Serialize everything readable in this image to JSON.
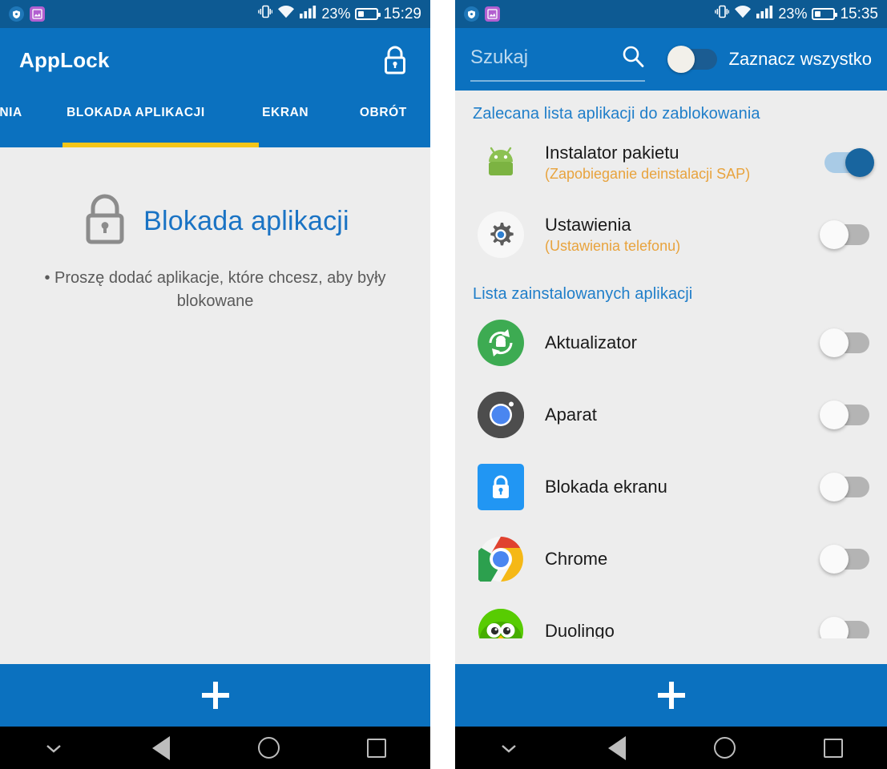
{
  "left": {
    "status_bar": {
      "icons": [
        "shield-icon",
        "gallery-icon",
        "vibrate-icon",
        "wifi-icon",
        "signal-icon"
      ],
      "battery_percent": "23%",
      "clock": "15:29"
    },
    "app_title": "AppLock",
    "lock_icon": "lock-icon",
    "tabs": [
      {
        "label": "ENIA",
        "active": false
      },
      {
        "label": "BLOKADA APLIKACJI",
        "active": true
      },
      {
        "label": "EKRAN",
        "active": false
      },
      {
        "label": "OBRÓT",
        "active": false
      }
    ],
    "empty_state": {
      "icon": "lock-outline-icon",
      "title": "Blokada aplikacji",
      "message": "• Proszę dodać aplikacje, które chcesz, aby były blokowane"
    },
    "add_button_label": "+",
    "nav_bar": [
      "chevron-down-icon",
      "back-icon",
      "home-icon",
      "recents-icon"
    ]
  },
  "right": {
    "status_bar": {
      "icons": [
        "shield-icon",
        "gallery-icon",
        "vibrate-icon",
        "wifi-icon",
        "signal-icon"
      ],
      "battery_percent": "23%",
      "clock": "15:35"
    },
    "search": {
      "placeholder": "Szukaj",
      "value": "",
      "icon": "search-icon"
    },
    "select_all": {
      "label": "Zaznacz wszystko",
      "enabled": false
    },
    "sections": [
      {
        "title": "Zalecana lista aplikacji do zablokowania",
        "apps": [
          {
            "name": "Instalator pakietu",
            "desc": "(Zapobieganie deinstalacji SAP)",
            "icon": "android-robot-icon",
            "enabled": true
          },
          {
            "name": "Ustawienia",
            "desc": "(Ustawienia telefonu)",
            "icon": "gear-icon",
            "enabled": false
          }
        ]
      },
      {
        "title": "Lista zainstalowanych aplikacji",
        "apps": [
          {
            "name": "Aktualizator",
            "desc": "",
            "icon": "updater-icon",
            "enabled": false
          },
          {
            "name": "Aparat",
            "desc": "",
            "icon": "camera-icon",
            "enabled": false
          },
          {
            "name": "Blokada ekranu",
            "desc": "",
            "icon": "screen-lock-icon",
            "enabled": false
          },
          {
            "name": "Chrome",
            "desc": "",
            "icon": "chrome-icon",
            "enabled": false
          },
          {
            "name": "Duolingo",
            "desc": "",
            "icon": "duolingo-owl-icon",
            "enabled": false
          }
        ]
      }
    ],
    "add_button_label": "+",
    "nav_bar": [
      "chevron-down-icon",
      "back-icon",
      "home-icon",
      "recents-icon"
    ]
  },
  "colors": {
    "app_bar_blue": "#0b71bf",
    "status_bar_blue": "#0d5a93",
    "tab_indicator_yellow": "#f5c518",
    "section_title_blue": "#1f7ec9",
    "app_desc_orange": "#e8a33d",
    "background_gray": "#ededed"
  }
}
